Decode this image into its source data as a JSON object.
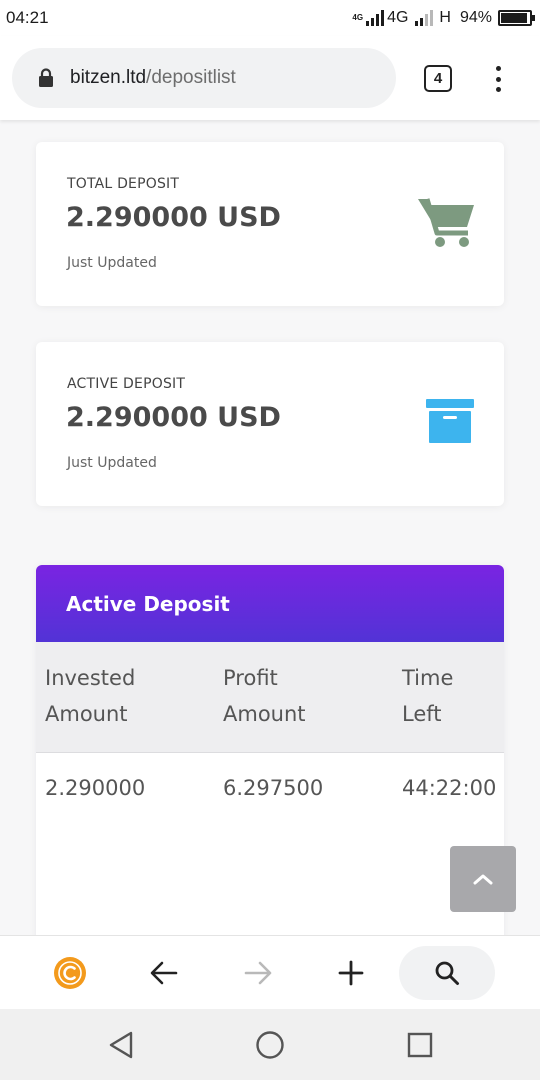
{
  "status_bar": {
    "time": "04:21",
    "net_tag_1": "4G",
    "net_label": "4G",
    "net_label_2": "H",
    "battery_percent": "94%",
    "battery_level": 0.94
  },
  "browser": {
    "url_host": "bitzen.ltd",
    "url_path": "/depositlist",
    "tab_count": "4"
  },
  "cards": [
    {
      "label": "TOTAL DEPOSIT",
      "value": "2.290000 USD",
      "status": "Just Updated",
      "icon": "shopping-cart-icon",
      "icon_color": "#7d9a80"
    },
    {
      "label": "ACTIVE DEPOSIT",
      "value": "2.290000 USD",
      "status": "Just Updated",
      "icon": "archive-box-icon",
      "icon_color": "#3db4ee"
    }
  ],
  "deposit_table": {
    "title": "Active Deposit",
    "header_colors": [
      "#7a24e2",
      "#5233d6"
    ],
    "columns": [
      {
        "line1": "Invested",
        "line2": "Amount"
      },
      {
        "line1": "Profit",
        "line2": "Amount"
      },
      {
        "line1": "Time",
        "line2": "Left"
      }
    ],
    "rows": [
      {
        "invested": "2.290000",
        "profit": "6.297500",
        "time_left": "44:22:00"
      }
    ]
  },
  "toolbar": {
    "items": [
      "coin-logo-icon",
      "back-arrow-icon",
      "forward-arrow-icon",
      "plus-icon",
      "search-icon"
    ],
    "logo_color": "#f39a1c"
  },
  "system_nav": {
    "items": [
      "back-triangle-icon",
      "home-circle-icon",
      "recents-square-icon"
    ]
  }
}
